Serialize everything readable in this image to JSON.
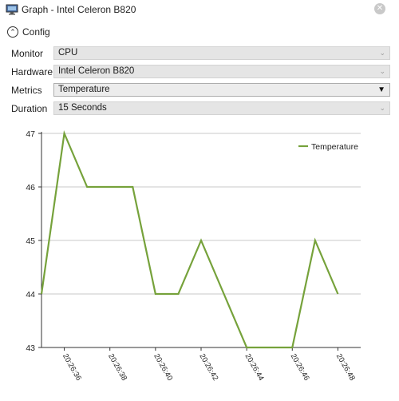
{
  "window": {
    "title": "Graph - Intel Celeron B820",
    "app_icon": "monitor-icon",
    "close_icon": "close-icon",
    "close_glyph": "✕"
  },
  "config": {
    "toggle_label": "Config",
    "toggle_icon": "chevron-up-icon",
    "toggle_glyph": "⌃"
  },
  "form": {
    "monitor": {
      "label": "Monitor",
      "value": "CPU"
    },
    "hardware": {
      "label": "Hardware",
      "value": "Intel Celeron B820"
    },
    "metrics": {
      "label": "Metrics",
      "value": "Temperature"
    },
    "duration": {
      "label": "Duration",
      "value": "15 Seconds"
    },
    "arrow_glyph": "⌄",
    "arrow_glyph_active": "▼"
  },
  "colors": {
    "series": "#76a23b",
    "axis": "#333333",
    "grid": "#c8c8c8"
  },
  "chart_data": {
    "type": "line",
    "title": "",
    "xlabel": "",
    "ylabel": "",
    "ylim": [
      43,
      47
    ],
    "yticks": [
      "47",
      "46",
      "45",
      "44",
      "43"
    ],
    "xticks": [
      "20:26:36",
      "20:26:38",
      "20:26:40",
      "20:26:42",
      "20:26:44",
      "20:26:46",
      "20:26:48"
    ],
    "xlim": [
      "20:26:35",
      "20:26:49"
    ],
    "grid": "horizontal",
    "legend_position": "top-right",
    "x": [
      "20:26:35",
      "20:26:36",
      "20:26:37",
      "20:26:38",
      "20:26:39",
      "20:26:40",
      "20:26:41",
      "20:26:42",
      "20:26:43",
      "20:26:44",
      "20:26:45",
      "20:26:46",
      "20:26:47",
      "20:26:48",
      "20:26:49"
    ],
    "series": [
      {
        "name": "Temperature",
        "values": [
          44,
          47,
          46,
          46,
          46,
          44,
          44,
          45,
          44,
          43,
          43,
          43,
          45,
          44
        ]
      }
    ]
  }
}
